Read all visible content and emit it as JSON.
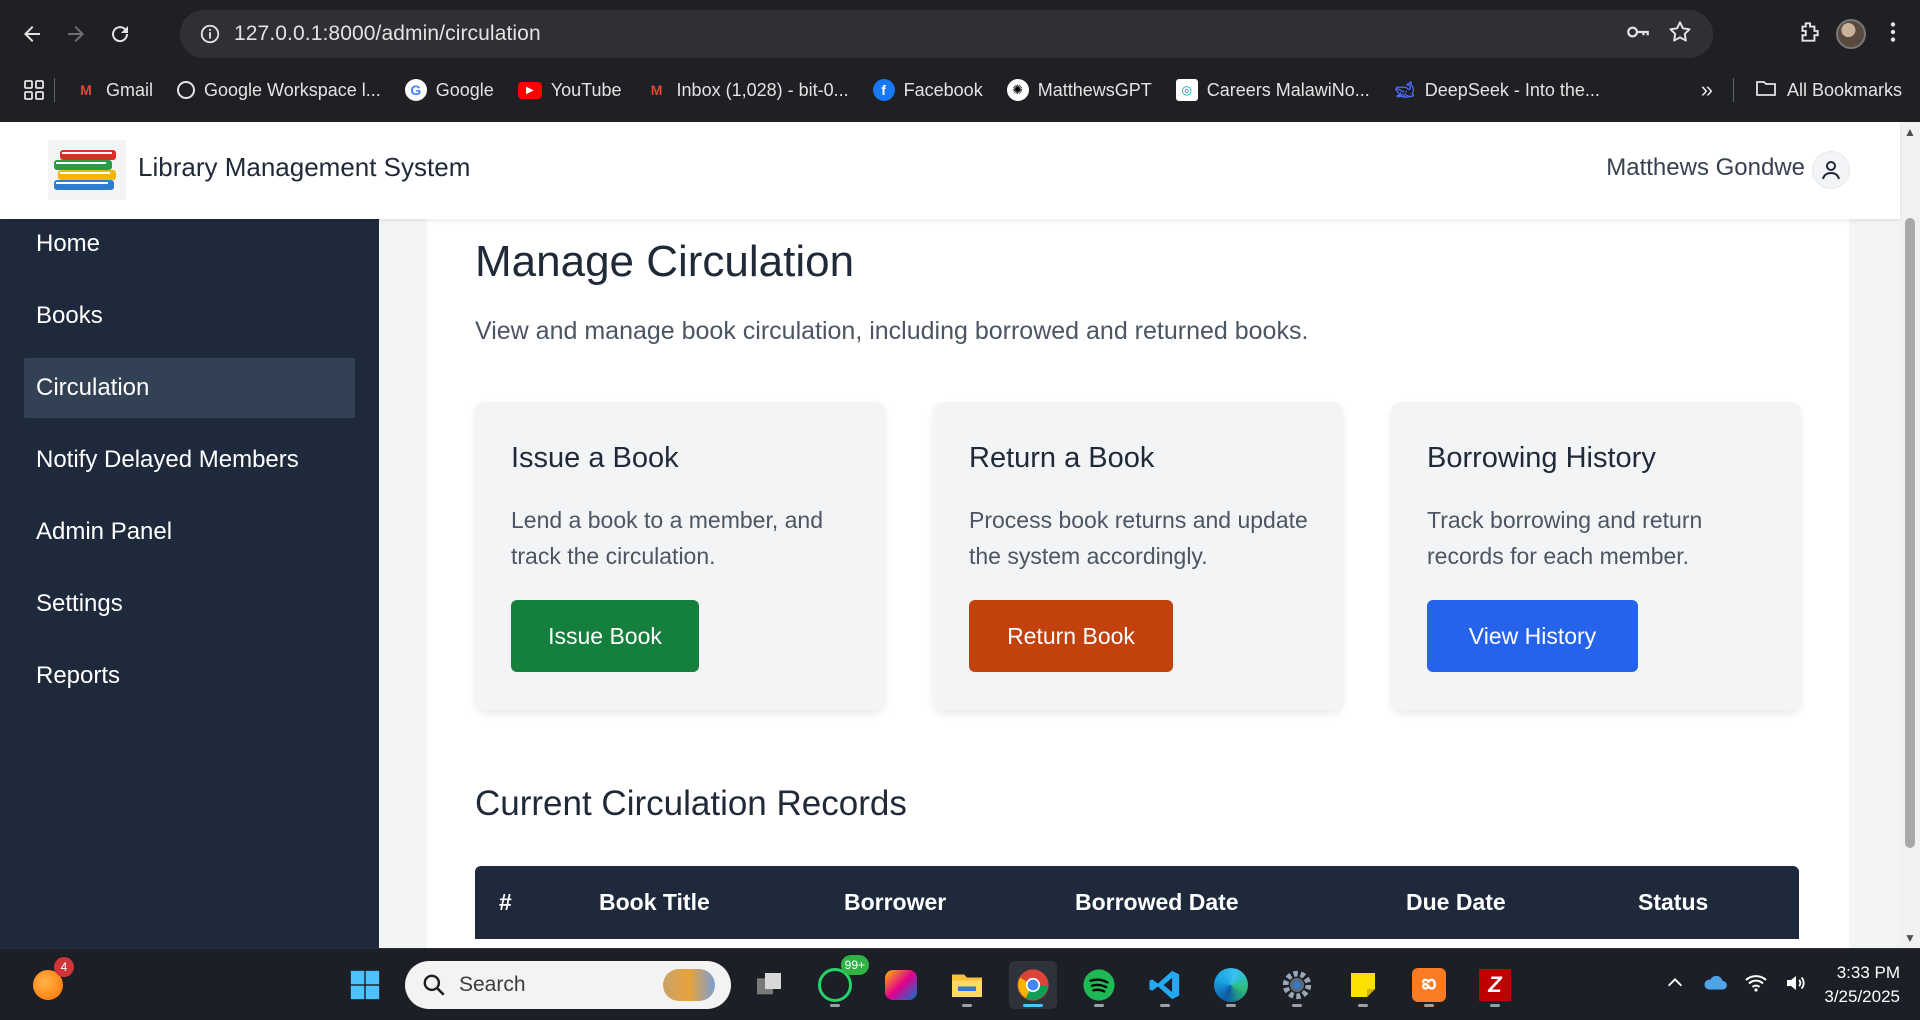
{
  "browser": {
    "url": "127.0.0.1:8000/admin/circulation",
    "bookmarks": [
      {
        "label": "Gmail",
        "icon": "gmail-icon"
      },
      {
        "label": "Google Workspace l...",
        "icon": "globe-icon"
      },
      {
        "label": "Google",
        "icon": "google-icon"
      },
      {
        "label": "YouTube",
        "icon": "youtube-icon"
      },
      {
        "label": "Inbox (1,028) - bit-0...",
        "icon": "gmail-icon"
      },
      {
        "label": "Facebook",
        "icon": "facebook-icon"
      },
      {
        "label": "MatthewsGPT",
        "icon": "openai-icon"
      },
      {
        "label": "Careers MalawiNo...",
        "icon": "careers-icon"
      },
      {
        "label": "DeepSeek - Into the...",
        "icon": "deepseek-icon"
      }
    ],
    "more_bookmarks": "»",
    "all_bookmarks": "All Bookmarks"
  },
  "app": {
    "title": "Library Management System",
    "user_name": "Matthews Gondwe"
  },
  "sidebar": {
    "items": [
      {
        "label": "Home",
        "active": false
      },
      {
        "label": "Books",
        "active": false
      },
      {
        "label": "Circulation",
        "active": true
      },
      {
        "label": "Notify Delayed Members",
        "active": false
      },
      {
        "label": "Admin Panel",
        "active": false
      },
      {
        "label": "Settings",
        "active": false
      },
      {
        "label": "Reports",
        "active": false
      }
    ]
  },
  "main": {
    "heading": "Manage Circulation",
    "description": "View and manage book circulation, including borrowed and returned books.",
    "cards": [
      {
        "title": "Issue a Book",
        "text": "Lend a book to a member, and track the circulation.",
        "button": "Issue Book",
        "color": "#15803d"
      },
      {
        "title": "Return a Book",
        "text": "Process book returns and update the system accordingly.",
        "button": "Return Book",
        "color": "#c2410c"
      },
      {
        "title": "Borrowing History",
        "text": "Track borrowing and return records for each member.",
        "button": "View History",
        "color": "#2563eb"
      }
    ],
    "records_heading": "Current Circulation Records",
    "table_headers": [
      "#",
      "Book Title",
      "Borrower",
      "Borrowed Date",
      "Due Date",
      "Status"
    ]
  },
  "taskbar": {
    "search_placeholder": "Search",
    "notification_count": "4",
    "whatsapp_badge": "99+",
    "time": "3:33 PM",
    "date": "3/25/2025"
  },
  "colors": {
    "sidebar_bg": "#1e293b",
    "active_item": "#334155",
    "table_header_bg": "#1e293b"
  }
}
